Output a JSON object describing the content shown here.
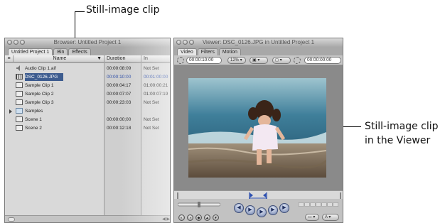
{
  "callouts": {
    "still_clip": "Still-image clip",
    "viewer_line1": "Still-image clip",
    "viewer_line2": "in the Viewer"
  },
  "browser": {
    "title": "Browser: Untitled Project 1",
    "tabs": [
      "Untitled Project 1",
      "Bin",
      "Effects"
    ],
    "columns": {
      "name": "Name",
      "duration": "Duration",
      "in": "In"
    },
    "rows": [
      {
        "name": "Audio Clip 1.aif",
        "duration": "00:00:08:09",
        "in": "Not Set",
        "icon": "speaker-icon"
      },
      {
        "name": "DSC_0126.JPG",
        "duration": "00:00:10:00",
        "in": "00:01:00:00",
        "icon": "still-image-icon",
        "selected": true
      },
      {
        "name": "Sample Clip 1",
        "duration": "00:00:04:17",
        "in": "01:00:00:21",
        "icon": "clip-icon"
      },
      {
        "name": "Sample Clip 2",
        "duration": "00:00:07:07",
        "in": "01:00:07:19",
        "icon": "clip-icon"
      },
      {
        "name": "Sample Clip 3",
        "duration": "00:00:23:03",
        "in": "Not Set",
        "icon": "clip-icon"
      },
      {
        "name": "Samples",
        "duration": "",
        "in": "",
        "icon": "folder-icon"
      },
      {
        "name": "Scene 1",
        "duration": "00:00:00;00",
        "in": "Not Set",
        "icon": "sequence-icon"
      },
      {
        "name": "Scene 2",
        "duration": "00:00:12:18",
        "in": "Not Set",
        "icon": "sequence-icon"
      }
    ]
  },
  "viewer": {
    "title": "Viewer: DSC_0126.JPG in Untitled Project 1",
    "tabs": [
      "Video",
      "Filters",
      "Motion"
    ],
    "duration_tc": "00:00:10:00",
    "zoom": "12%",
    "current_tc": "00:00:00:00"
  },
  "colors": {
    "selection": "#3d5c8f",
    "selected_text": "#2d4ea8",
    "transport_blue": "#6c7eaa"
  }
}
